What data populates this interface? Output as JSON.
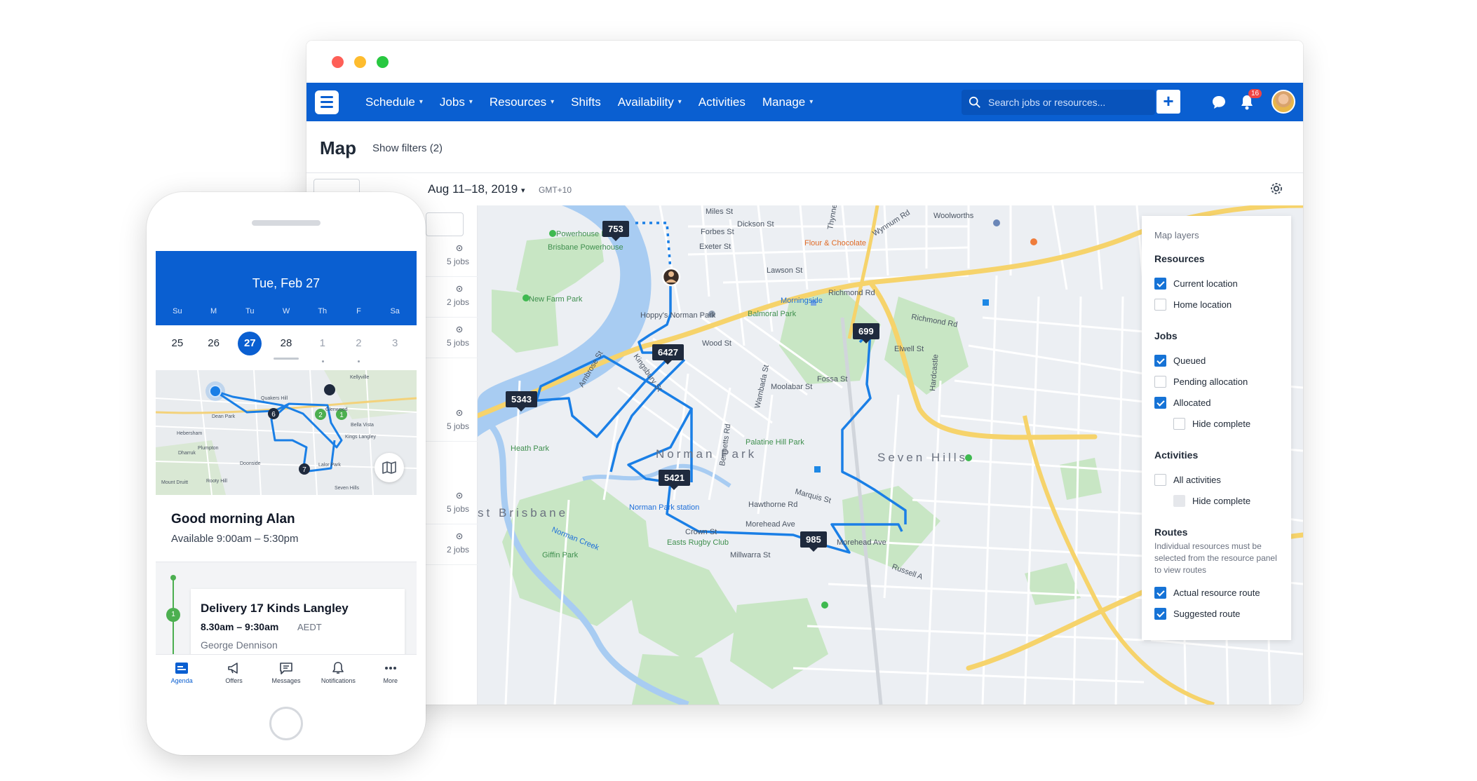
{
  "window": {
    "controls": [
      "close",
      "minimize",
      "maximize"
    ]
  },
  "nav": {
    "items": [
      {
        "label": "Schedule",
        "dropdown": true
      },
      {
        "label": "Jobs",
        "dropdown": true
      },
      {
        "label": "Resources",
        "dropdown": true
      },
      {
        "label": "Shifts",
        "dropdown": false
      },
      {
        "label": "Availability",
        "dropdown": true
      },
      {
        "label": "Activities",
        "dropdown": false
      },
      {
        "label": "Manage",
        "dropdown": true
      }
    ],
    "search_placeholder": "Search jobs or resources...",
    "add_label": "+",
    "notification_count": "16"
  },
  "page": {
    "title": "Map",
    "filters_label": "Show filters (2)",
    "date_range": "Aug 11–18, 2019",
    "timezone": "GMT+10"
  },
  "resource_list": [
    {
      "count": "5 jobs"
    },
    {
      "count": "2 jobs"
    },
    {
      "count": "5 jobs"
    },
    {
      "count": "5 jobs"
    },
    {
      "count": "5 jobs"
    },
    {
      "count": "2 jobs"
    }
  ],
  "map": {
    "job_markers": [
      "753",
      "6427",
      "5343",
      "5421",
      "699",
      "985"
    ],
    "labels": {
      "powerhouse_park": "Powerhouse Park",
      "brisbane_powerhouse": "Brisbane Powerhouse",
      "new_farm_park": "New Farm Park",
      "hoppys": "Hoppy's Norman Park",
      "balmoral_park": "Balmoral Park",
      "morningside": "Morningside",
      "flour_chocolate": "Flour & Chocolate",
      "woolworths": "Woolworths",
      "wynnum_rd": "Wynnum Rd",
      "richmond_rd": "Richmond Rd",
      "heath_park": "Heath Park",
      "norman_park": "Norman Park",
      "seven_hills": "Seven Hills",
      "palatine_hill_park": "Palatine Hill Park",
      "norman_park_station": "Norman Park station",
      "easts_rugby_club": "Easts Rugby Club",
      "giffin_park": "Giffin Park",
      "norman_creek": "Norman Creek",
      "east_brisbane": "st Brisbane",
      "miles_st": "Miles St",
      "forbes_st": "Forbes St",
      "dickson_st": "Dickson St",
      "exeter_st": "Exeter St",
      "lawson_st": "Lawson St",
      "wambada_st": "Wambada St",
      "bennetts_rd": "Bennetts Rd",
      "kingsbury_st": "Kingsbury St",
      "moolabar_st": "Moolabar St",
      "fossa_st": "Fossa St",
      "morehead_ave": "Morehead Ave",
      "russell_ave": "Russell A",
      "crown_st": "Crown St",
      "millwarra_st": "Millwarra St",
      "hawthorne_rd": "Hawthorne Rd",
      "marquis_st": "Marquis St",
      "thynne_rd": "Thynne Rd",
      "elwell_st": "Elwell St",
      "ambrose_st": "Ambrose St",
      "wood_st": "Wood St",
      "hardcastle": "Hardcastle"
    }
  },
  "map_layers": {
    "title": "Map layers",
    "groups": [
      {
        "title": "Resources",
        "items": [
          {
            "label": "Current location",
            "checked": true,
            "sub": false,
            "disabled": false
          },
          {
            "label": "Home location",
            "checked": false,
            "sub": false,
            "disabled": false
          }
        ]
      },
      {
        "title": "Jobs",
        "items": [
          {
            "label": "Queued",
            "checked": true,
            "sub": false,
            "disabled": false
          },
          {
            "label": "Pending allocation",
            "checked": false,
            "sub": false,
            "disabled": false
          },
          {
            "label": "Allocated",
            "checked": true,
            "sub": false,
            "disabled": false
          },
          {
            "label": "Hide complete",
            "checked": false,
            "sub": true,
            "disabled": false
          }
        ]
      },
      {
        "title": "Activities",
        "items": [
          {
            "label": "All activities",
            "checked": false,
            "sub": false,
            "disabled": false
          },
          {
            "label": "Hide complete",
            "checked": false,
            "sub": true,
            "disabled": true
          }
        ]
      },
      {
        "title": "Routes",
        "note": "Individual resources must be selected from the resource panel to view routes",
        "items": [
          {
            "label": "Actual resource route",
            "checked": true,
            "sub": false,
            "disabled": false
          },
          {
            "label": "Suggested route",
            "checked": true,
            "sub": false,
            "disabled": false
          }
        ]
      }
    ]
  },
  "phone": {
    "date": "Tue, Feb 27",
    "weekdays": [
      "Su",
      "M",
      "Tu",
      "W",
      "Th",
      "F",
      "Sa"
    ],
    "days": [
      {
        "num": "25",
        "selected": false,
        "faded": false
      },
      {
        "num": "26",
        "selected": false,
        "faded": false
      },
      {
        "num": "27",
        "selected": true,
        "faded": false
      },
      {
        "num": "28",
        "selected": false,
        "faded": false
      },
      {
        "num": "1",
        "selected": false,
        "faded": true
      },
      {
        "num": "2",
        "selected": false,
        "faded": true
      },
      {
        "num": "3",
        "selected": false,
        "faded": true
      }
    ],
    "map_labels": {
      "quakers_hill": "Quakers Hill",
      "kellyville": "Kellyville",
      "glenwood": "Glenwood",
      "bella_vista": "Bella Vista",
      "kings_langley": "Kings Langley",
      "plumpton": "Plumpton",
      "hebersham": "Hebersham",
      "doonside": "Doonside",
      "lalor_park": "Lalor Park",
      "seven_hills": "Seven Hills",
      "mt_druitt": "Mount Druitt",
      "rooty_hill": "Rooty Hill",
      "dean_park": "Dean Park",
      "dharruk": "Dharruk"
    },
    "map_stops": [
      "6",
      "2",
      "1",
      "7"
    ],
    "greeting": "Good morning Alan",
    "availability": "Available 9:00am – 5:30pm",
    "job": {
      "step": "1",
      "title": "Delivery 17 Kinds Langley",
      "time": "8.30am – 9:30am",
      "tz": "AEDT",
      "customer": "George Dennison"
    },
    "tabs": [
      {
        "label": "Agenda",
        "icon": "agenda-icon",
        "active": true
      },
      {
        "label": "Offers",
        "icon": "megaphone-icon",
        "active": false
      },
      {
        "label": "Messages",
        "icon": "message-icon",
        "active": false
      },
      {
        "label": "Notifications",
        "icon": "bell-icon",
        "active": false
      },
      {
        "label": "More",
        "icon": "more-icon",
        "active": false
      }
    ]
  },
  "colors": {
    "brand": "#0a5fd1",
    "route": "#1a7fe6",
    "marker": "#1f2a3d",
    "park": "#c8e6c4",
    "water": "#a8ccf2",
    "major_road": "#f6d36b"
  }
}
